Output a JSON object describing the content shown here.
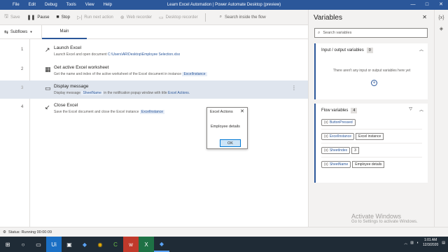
{
  "titlebar": {
    "menu": [
      "File",
      "Edit",
      "Debug",
      "Tools",
      "View",
      "Help"
    ],
    "title": "Learn Excel Automation | Power Automate Desktop (preview)",
    "controls": [
      "—",
      "□",
      "✕"
    ]
  },
  "toolbar": {
    "save": "Save",
    "pause": "Pause",
    "stop": "Stop",
    "run_next": "Run next action",
    "web_recorder": "Web recorder",
    "desktop_recorder": "Desktop recorder",
    "search_placeholder": "Search inside the flow"
  },
  "tabs": {
    "subflows": "Subflows",
    "main": "Main"
  },
  "steps": [
    {
      "num": "1",
      "title": "Launch Excel",
      "desc_pre": "Launch Excel and open document ",
      "desc_var": "C:\\Users\\AR\\Desktop\\Employee Selection.xlsx",
      "desc_post": ""
    },
    {
      "num": "2",
      "title": "Get active Excel worksheet",
      "desc_pre": "Get the name and index of the active worksheet of the Excel document in instance ",
      "desc_var": "ExcelInstance",
      "desc_post": ""
    },
    {
      "num": "3",
      "title": "Display message",
      "desc_pre": "Display message ",
      "desc_var": "SheetName",
      "desc_post": " in the notification popup window with title ",
      "desc_var2": "Excel Actions."
    },
    {
      "num": "4",
      "title": "Close Excel",
      "desc_pre": "Save the Excel document and close the Excel instance ",
      "desc_var": "ExcelInstance",
      "desc_post": ""
    }
  ],
  "dialog": {
    "title": "Excel Actions",
    "message": "Employee details",
    "ok": "OK"
  },
  "status": {
    "text": "Status: Running  00:00:09"
  },
  "variables": {
    "title": "Variables",
    "search_placeholder": "Search variables",
    "io_header": "Input / output variables",
    "io_count": "0",
    "io_empty": "There aren't any input or output variables here yet",
    "flow_header": "Flow variables",
    "flow_count": "4",
    "flow_vars": [
      {
        "name": "ButtonPressed",
        "value": ""
      },
      {
        "name": "ExcelInstance",
        "value": "Excel instance"
      },
      {
        "name": "SheetIndex",
        "value": "3"
      },
      {
        "name": "SheetName",
        "value": "Employee details"
      }
    ]
  },
  "watermark": {
    "line1": "Activate Windows",
    "line2": "Go to Settings to activate Windows."
  },
  "taskbar": {
    "time": "1:01 AM",
    "date": "12/3/2020"
  }
}
